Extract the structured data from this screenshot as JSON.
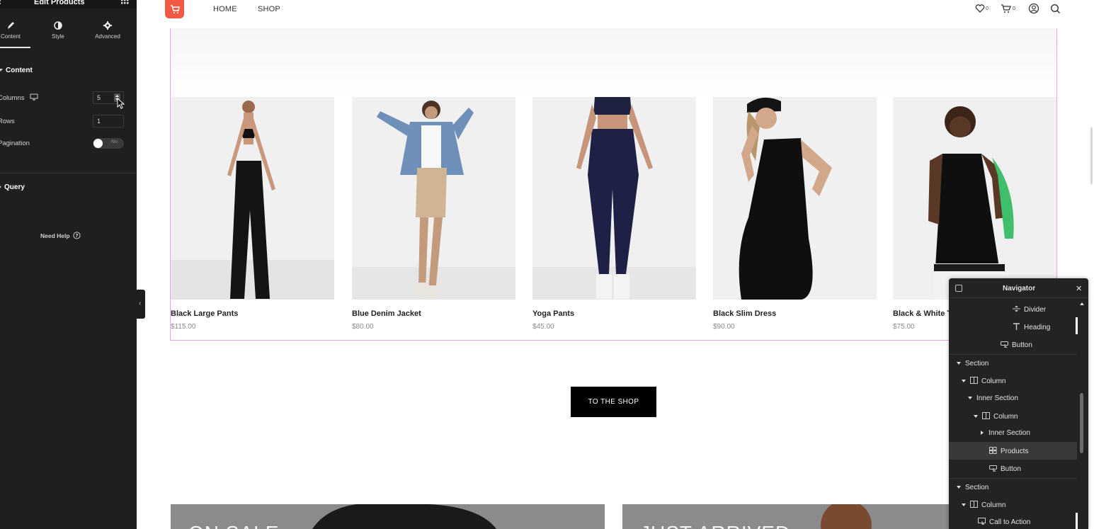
{
  "panel": {
    "title": "Edit Products",
    "tabs": [
      {
        "label": "Content",
        "icon": "pencil-icon"
      },
      {
        "label": "Style",
        "icon": "contrast-icon"
      },
      {
        "label": "Advanced",
        "icon": "gear-icon"
      }
    ],
    "content_section": "Content",
    "columns_label": "Columns",
    "columns_value": "5",
    "rows_label": "Rows",
    "rows_value": "1",
    "pagination_label": "Pagination",
    "pagination_value": "No",
    "query_section": "Query",
    "help": "Need Help"
  },
  "header": {
    "nav": [
      "HOME",
      "SHOP"
    ],
    "wishlist_count": "0",
    "cart_count": "0",
    "accent": "#f05a44"
  },
  "products": [
    {
      "name": "Black Large Pants",
      "price": "$115.00"
    },
    {
      "name": "Blue Denim Jacket",
      "price": "$80.00"
    },
    {
      "name": "Yoga Pants",
      "price": "$45.00"
    },
    {
      "name": "Black Slim Dress",
      "price": "$90.00"
    },
    {
      "name": "Black & White T",
      "price": "$75.00"
    }
  ],
  "shop_button": "TO THE SHOP",
  "banners": [
    "ON SALE",
    "JUST ARRIVED"
  ],
  "navigator": {
    "title": "Navigator",
    "rows": [
      {
        "label": "Divider",
        "icon": "divider-icon"
      },
      {
        "label": "Heading",
        "icon": "heading-icon"
      },
      {
        "label": "Button",
        "icon": "button-icon"
      },
      {
        "label": "Section",
        "icon": "none"
      },
      {
        "label": "Column",
        "icon": "column-icon"
      },
      {
        "label": "Inner Section",
        "icon": "none"
      },
      {
        "label": "Column",
        "icon": "column-icon"
      },
      {
        "label": "Inner Section",
        "icon": "none"
      },
      {
        "label": "Products",
        "icon": "grid-icon"
      },
      {
        "label": "Button",
        "icon": "button-icon"
      },
      {
        "label": "Section",
        "icon": "none"
      },
      {
        "label": "Column",
        "icon": "column-icon"
      },
      {
        "label": "Call to Action",
        "icon": "cta-icon"
      }
    ]
  }
}
